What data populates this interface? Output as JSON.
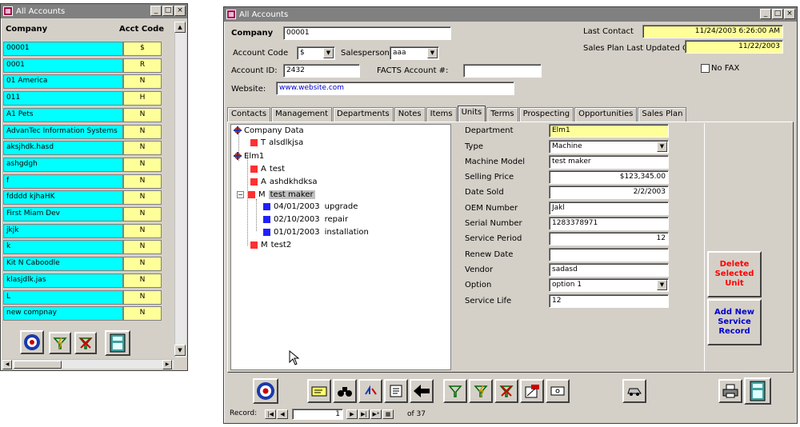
{
  "left_window": {
    "title": "All Accounts",
    "col_company": "Company",
    "col_acct": "Acct Code",
    "rows": [
      {
        "company": "00001",
        "code": "$"
      },
      {
        "company": "0001",
        "code": "R"
      },
      {
        "company": "01 America",
        "code": "N"
      },
      {
        "company": "011",
        "code": "H"
      },
      {
        "company": "A1 Pets",
        "code": "N"
      },
      {
        "company": "AdvanTec Information Systems",
        "code": "N"
      },
      {
        "company": "aksjhdk.hasd",
        "code": "N"
      },
      {
        "company": "ashgdgh",
        "code": "N"
      },
      {
        "company": "f",
        "code": "N"
      },
      {
        "company": "fdddd kjhaHK",
        "code": "N"
      },
      {
        "company": "First Miam Dev",
        "code": "N"
      },
      {
        "company": "jkjk",
        "code": "N"
      },
      {
        "company": "k",
        "code": "N"
      },
      {
        "company": "Kit N Caboodle",
        "code": "N"
      },
      {
        "company": "klasjdlk.jas",
        "code": "N"
      },
      {
        "company": "L",
        "code": "N"
      },
      {
        "company": "new compnay",
        "code": "N"
      }
    ]
  },
  "main": {
    "title": "All Accounts",
    "company_label": "Company",
    "company_value": "00001",
    "acct_code_label": "Account Code",
    "acct_code_value": "$",
    "salesperson_label": "Salesperson",
    "salesperson_value": "aaa",
    "account_id_label": "Account ID:",
    "account_id_value": "2432",
    "facts_label": "FACTS Account #:",
    "facts_value": "",
    "website_label": "Website:",
    "website_value": "www.website.com",
    "last_contact_label": "Last Contact",
    "last_contact_value": "11/24/2003 6:26:00 AM",
    "sales_plan_label": "Sales Plan Last Updated On:",
    "sales_plan_value": "11/22/2003",
    "nofax_label": "No FAX",
    "tabs": [
      "Contacts",
      "Management",
      "Departments",
      "Notes",
      "Items",
      "Units",
      "Terms",
      "Prospecting",
      "Opportunities",
      "Sales Plan"
    ],
    "tree": {
      "n1": "Company Data",
      "n2_prefix": "T",
      "n2": "alsdlkjsa",
      "n3": "Elm1",
      "n4_prefix": "A",
      "n4": "test",
      "n5_prefix": "A",
      "n5": "ashdkhdksa",
      "n6_prefix": "M",
      "n6": "test maker",
      "n7_date": "04/01/2003",
      "n7": "upgrade",
      "n8_date": "02/10/2003",
      "n8": "repair",
      "n9_date": "01/01/2003",
      "n9": "installation",
      "n10_prefix": "M",
      "n10": "test2",
      "expander": "−"
    },
    "fields": {
      "department_label": "Department",
      "department": "Elm1",
      "type_label": "Type",
      "type": "Machine",
      "model_label": "Machine Model",
      "model": "test maker",
      "price_label": "Selling Price",
      "price": "$123,345.00",
      "date_sold_label": "Date Sold",
      "date_sold": "2/2/2003",
      "oem_label": "OEM Number",
      "oem": "Jakl",
      "serial_label": "Serial Number",
      "serial": "1283378971",
      "service_period_label": "Service Period",
      "service_period": "12",
      "renew_label": "Renew Date",
      "renew": "",
      "vendor_label": "Vendor",
      "vendor": "sadasd",
      "option_label": "Option",
      "option": "option 1",
      "service_life_label": "Service Life",
      "service_life": "12"
    },
    "delete_btn": "Delete Selected Unit",
    "add_btn": "Add New Service Record",
    "record_label": "Record:",
    "record_value": "1",
    "record_of": "of 37"
  },
  "colors": {
    "cyan": "#00ffff",
    "yellow": "#ffff99",
    "delete": "#ff0000",
    "add": "#0000cc"
  }
}
